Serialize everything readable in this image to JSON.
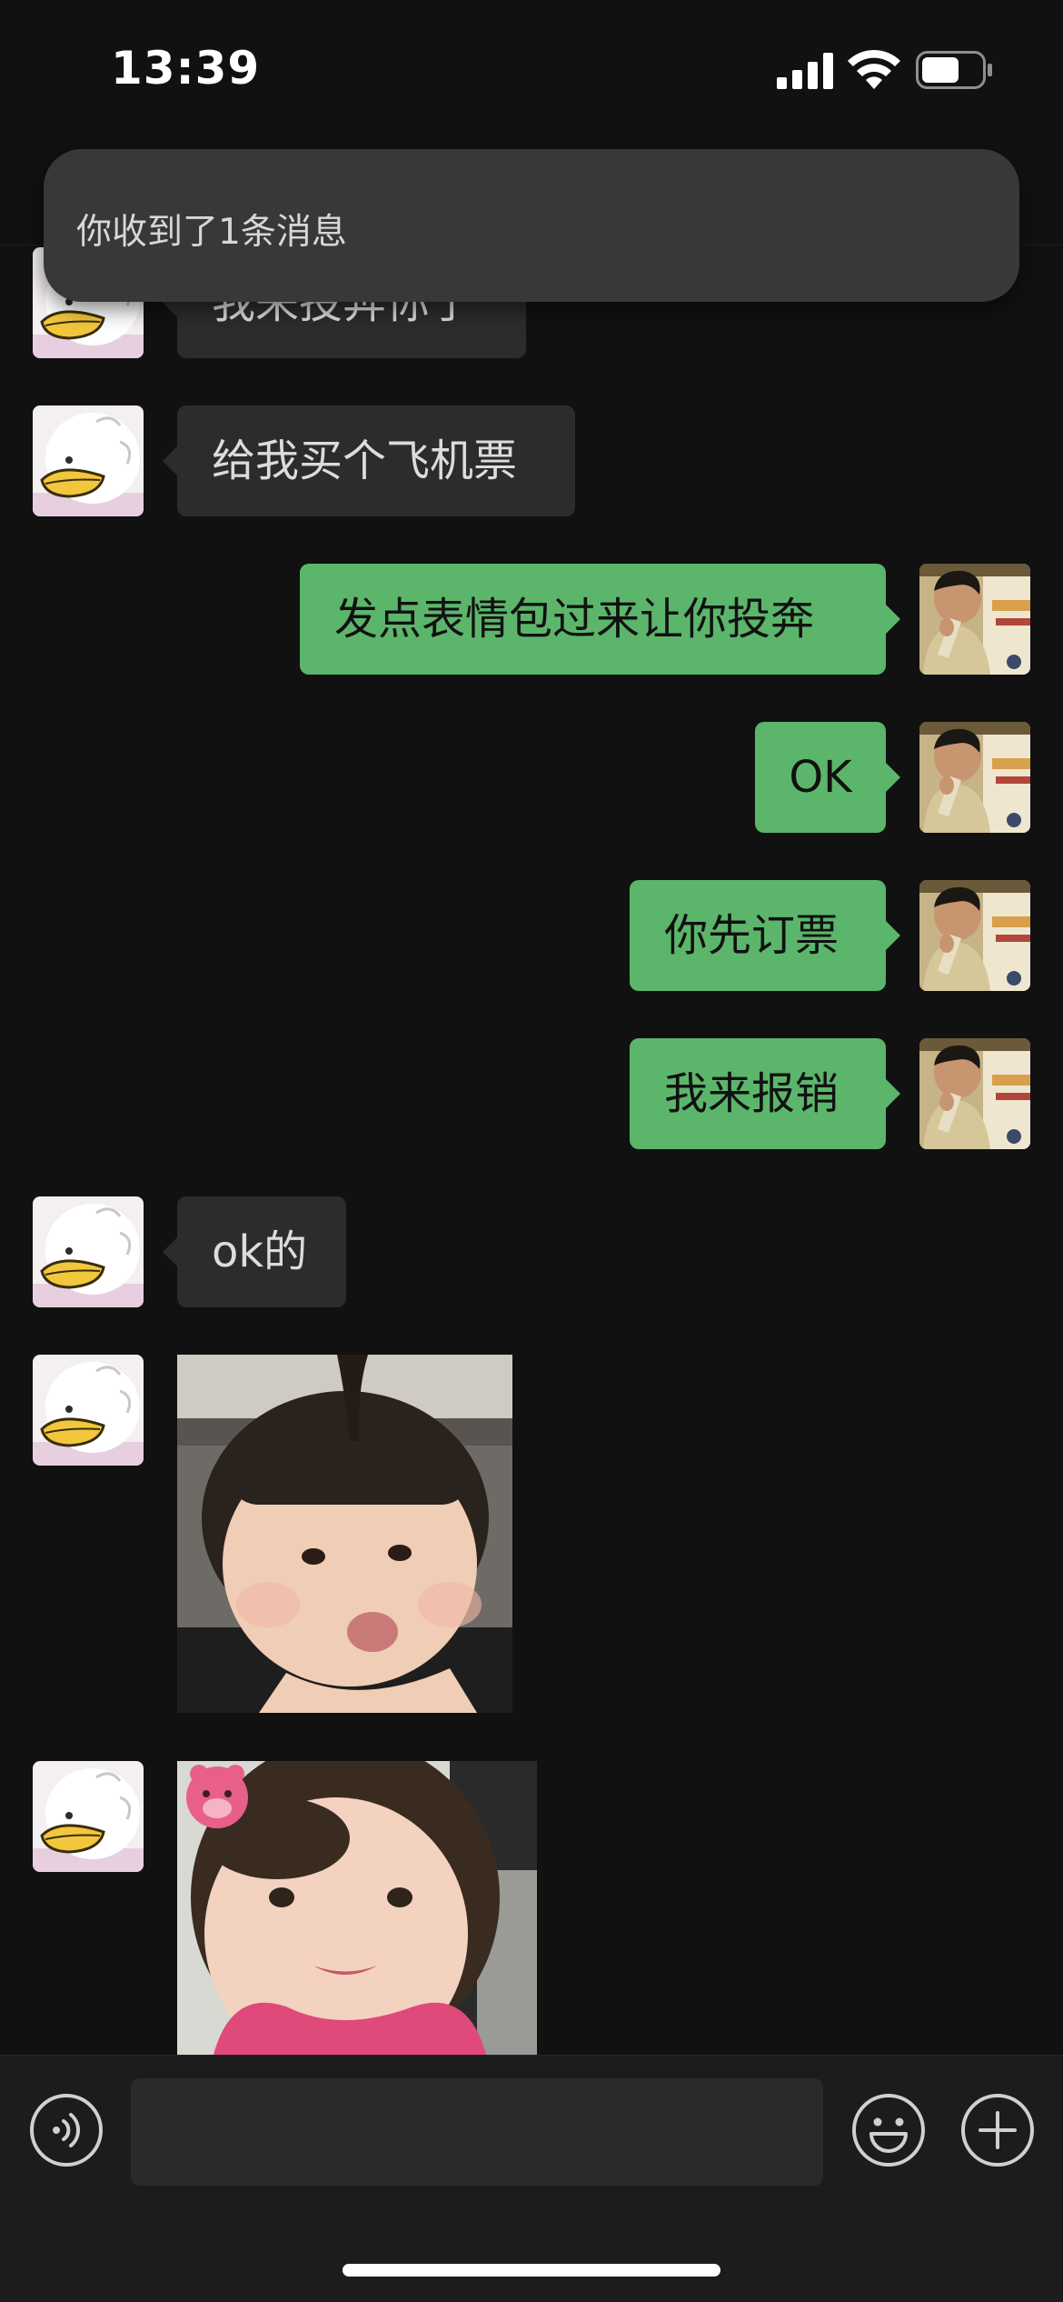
{
  "status_bar": {
    "time": "13:39",
    "icons": [
      "signal-icon",
      "wifi-icon",
      "battery-icon"
    ]
  },
  "notification": {
    "text": "你收到了1条消息"
  },
  "messages": [
    {
      "sender": "contact",
      "type": "text",
      "text": "我来投奔你了",
      "partially_hidden": true
    },
    {
      "sender": "contact",
      "type": "text",
      "text": "给我买个飞机票"
    },
    {
      "sender": "me",
      "type": "text",
      "text": "发点表情包过来让你投奔"
    },
    {
      "sender": "me",
      "type": "text",
      "text": "OK"
    },
    {
      "sender": "me",
      "type": "text",
      "text": "你先订票"
    },
    {
      "sender": "me",
      "type": "text",
      "text": "我来报销"
    },
    {
      "sender": "contact",
      "type": "text",
      "text": "ok的"
    },
    {
      "sender": "contact",
      "type": "sticker",
      "sticker": "baby-pout-photo"
    },
    {
      "sender": "contact",
      "type": "sticker",
      "sticker": "baby-smile-photo"
    }
  ],
  "input_bar": {
    "value": "",
    "icons": [
      "voice-icon",
      "emoji-icon",
      "plus-icon"
    ]
  },
  "colors": {
    "background": "#111111",
    "incoming_bubble": "#2c2c2c",
    "outgoing_bubble": "#5bb66b",
    "banner": "#383838"
  }
}
